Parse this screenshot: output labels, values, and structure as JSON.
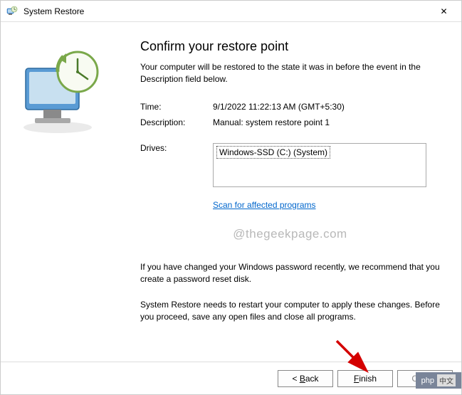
{
  "window": {
    "title": "System Restore",
    "close_glyph": "✕"
  },
  "heading": "Confirm your restore point",
  "intro": "Your computer will be restored to the state it was in before the event in the Description field below.",
  "fields": {
    "time_label": "Time:",
    "time_value": "9/1/2022 11:22:13 AM (GMT+5:30)",
    "desc_label": "Description:",
    "desc_value": "Manual: system restore point 1",
    "drives_label": "Drives:",
    "drive_item": "Windows-SSD (C:) (System)"
  },
  "scan_link": "Scan for affected programs",
  "watermark": "@thegeekpage.com",
  "note_password": "If you have changed your Windows password recently, we recommend that you create a password reset disk.",
  "note_restart": "System Restore needs to restart your computer to apply these changes. Before you proceed, save any open files and close all programs.",
  "buttons": {
    "back_prefix": "< ",
    "back_key": "B",
    "back_rest": "ack",
    "finish_key": "F",
    "finish_rest": "inish",
    "cancel": "Cancel"
  },
  "badge": {
    "text": "php",
    "sub": "中文"
  }
}
